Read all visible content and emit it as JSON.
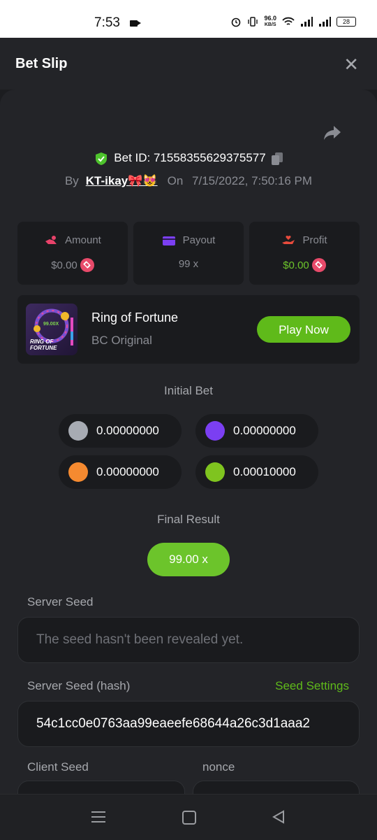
{
  "status_bar": {
    "time": "7:53",
    "speed": "96.0",
    "speed_unit": "KB/S",
    "battery": "28"
  },
  "header": {
    "title": "Bet Slip"
  },
  "bet": {
    "id_label": "Bet ID: 71558355629375577",
    "by_label": "By",
    "user": "KT-ikay🎀😻",
    "on_label": "On",
    "date": "7/15/2022, 7:50:16 PM"
  },
  "stats": {
    "amount_label": "Amount",
    "amount_value": "$0.00",
    "payout_label": "Payout",
    "payout_value": "99 x",
    "profit_label": "Profit",
    "profit_value": "$0.00"
  },
  "game": {
    "name": "Ring of Fortune",
    "provider": "BC Original",
    "play_label": "Play Now",
    "thumb_multiplier": "99.00X",
    "thumb_title_line1": "RING OF",
    "thumb_title_line2": "FORTUNE"
  },
  "initial_bet": {
    "label": "Initial Bet",
    "coins": [
      {
        "amount": "0.00000000",
        "color": "#a7abb3"
      },
      {
        "amount": "0.00000000",
        "color": "#7b3ff2"
      },
      {
        "amount": "0.00000000",
        "color": "#f58a30"
      },
      {
        "amount": "0.00010000",
        "color": "#7fc41f"
      }
    ]
  },
  "final_result": {
    "label": "Final Result",
    "value": "99.00 x"
  },
  "server_seed": {
    "label": "Server Seed",
    "value": "The seed hasn't been revealed yet."
  },
  "server_seed_hash": {
    "label": "Server Seed (hash)",
    "settings_link": "Seed Settings",
    "value": "54c1cc0e0763aa99eaeefe68644a26c3d1aaa2"
  },
  "client_seed": {
    "label": "Client Seed"
  },
  "nonce": {
    "label": "nonce"
  },
  "colors": {
    "accent": "#6cc42b",
    "background": "#232428",
    "card": "#1a1b1e"
  }
}
